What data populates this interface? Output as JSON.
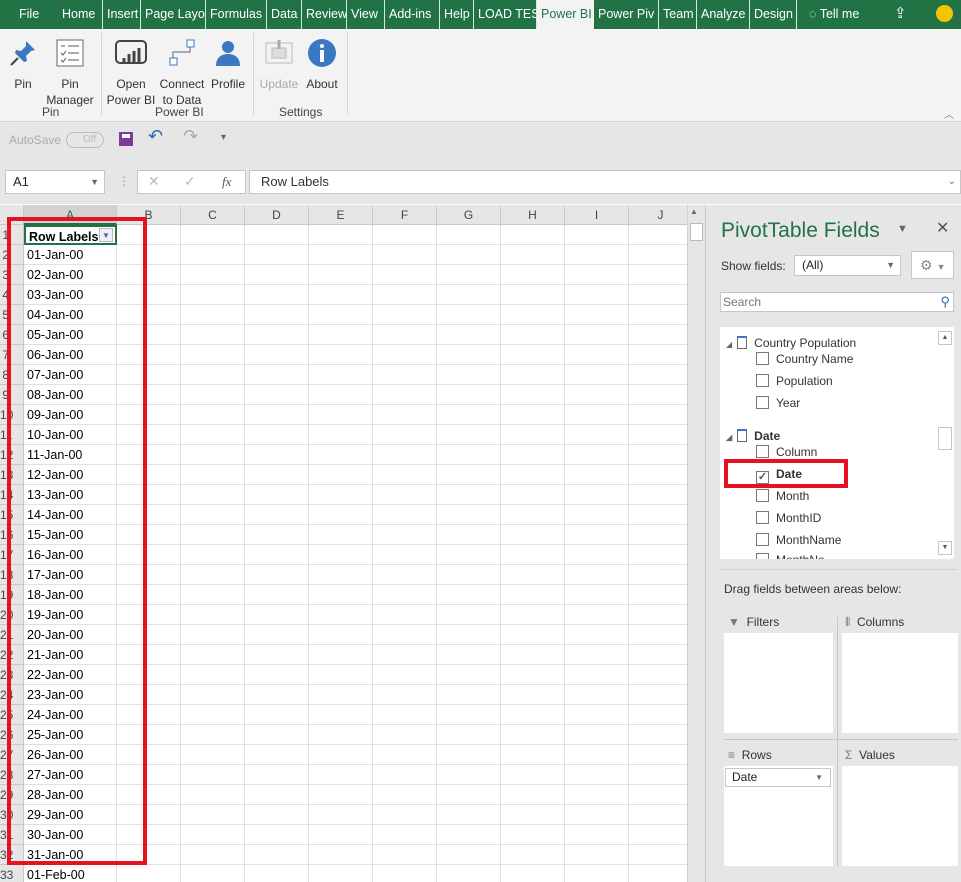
{
  "tabs": [
    {
      "label": "File"
    },
    {
      "label": "Home"
    },
    {
      "label": "Insert"
    },
    {
      "label": "Page Layo"
    },
    {
      "label": "Formulas"
    },
    {
      "label": "Data"
    },
    {
      "label": "Review"
    },
    {
      "label": "View"
    },
    {
      "label": "Add-ins"
    },
    {
      "label": "Help"
    },
    {
      "label": "LOAD TES"
    },
    {
      "label": "Power BI",
      "active": true
    },
    {
      "label": "Power Piv"
    },
    {
      "label": "Team"
    },
    {
      "label": "Analyze"
    },
    {
      "label": "Design"
    }
  ],
  "tell_me": "Tell me",
  "ribbon": {
    "buttons": [
      {
        "label": "Pin",
        "icon": "pin-icon"
      },
      {
        "label": "Pin\nManager",
        "icon": "checklist-icon"
      },
      {
        "label": "Open\nPower BI",
        "icon": "powerbi-icon"
      },
      {
        "label": "Connect\nto Data",
        "icon": "connect-icon"
      },
      {
        "label": "Profile",
        "icon": "profile-icon"
      },
      {
        "label": "Update",
        "icon": "update-icon",
        "disabled": true
      },
      {
        "label": "About",
        "icon": "info-icon"
      }
    ],
    "groups": [
      "Pin",
      "Power BI",
      "Settings"
    ]
  },
  "qat": {
    "autosave": "AutoSave",
    "toggle": "Off"
  },
  "formula": {
    "name_box": "A1",
    "fx": "fx",
    "value": "Row Labels"
  },
  "columns": [
    "A",
    "B",
    "C",
    "D",
    "E",
    "F",
    "G",
    "H",
    "I",
    "J"
  ],
  "rows": [
    "Row Labels",
    "01-Jan-00",
    "02-Jan-00",
    "03-Jan-00",
    "04-Jan-00",
    "05-Jan-00",
    "06-Jan-00",
    "07-Jan-00",
    "08-Jan-00",
    "09-Jan-00",
    "10-Jan-00",
    "11-Jan-00",
    "12-Jan-00",
    "13-Jan-00",
    "14-Jan-00",
    "15-Jan-00",
    "16-Jan-00",
    "17-Jan-00",
    "18-Jan-00",
    "19-Jan-00",
    "20-Jan-00",
    "21-Jan-00",
    "22-Jan-00",
    "23-Jan-00",
    "24-Jan-00",
    "25-Jan-00",
    "26-Jan-00",
    "27-Jan-00",
    "28-Jan-00",
    "29-Jan-00",
    "30-Jan-00",
    "31-Jan-00",
    "01-Feb-00"
  ],
  "colors": {
    "excel_green": "#217346",
    "highlight_red": "#e81123"
  },
  "pane": {
    "title": "PivotTable Fields",
    "show_fields_label": "Show fields:",
    "show_fields_value": "(All)",
    "search_placeholder": "Search",
    "fields": [
      {
        "label": "Country Population",
        "type": "table"
      },
      {
        "label": "Country Name",
        "checked": false
      },
      {
        "label": "Population",
        "checked": false
      },
      {
        "label": "Year",
        "checked": false
      },
      {
        "label": "Date",
        "type": "table"
      },
      {
        "label": "Column",
        "checked": false
      },
      {
        "label": "Date",
        "checked": true
      },
      {
        "label": "Month",
        "checked": false
      },
      {
        "label": "MonthID",
        "checked": false
      },
      {
        "label": "MonthName",
        "checked": false
      },
      {
        "label": "MonthNo",
        "checked": false
      }
    ],
    "drag_hint": "Drag fields between areas below:",
    "areas": {
      "filters": "Filters",
      "columns": "Columns",
      "rows": "Rows",
      "values": "Values"
    },
    "rows_field": "Date"
  }
}
